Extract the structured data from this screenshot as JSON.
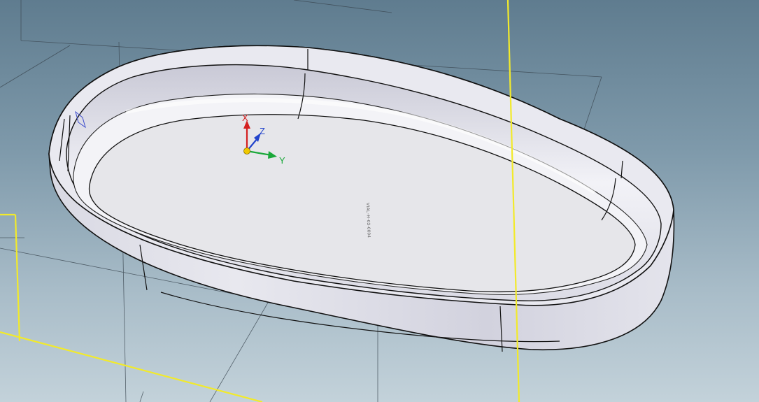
{
  "viewport": {
    "background_top": "#5f7c8f",
    "background_bottom": "#c3d2da",
    "datum_plane_color": "#f2ea2b"
  },
  "part": {
    "name": "shell-tray-body",
    "face_color": "#ececf2",
    "edge_color": "#111111",
    "engraved_text": "VIAL-H-03-0004"
  },
  "triad": {
    "x_label": "X",
    "y_label": "Y",
    "z_label": "Z",
    "x_color": "#d42020",
    "y_color": "#1aa83a",
    "z_color": "#2244cc",
    "origin_color": "#f0c800"
  }
}
